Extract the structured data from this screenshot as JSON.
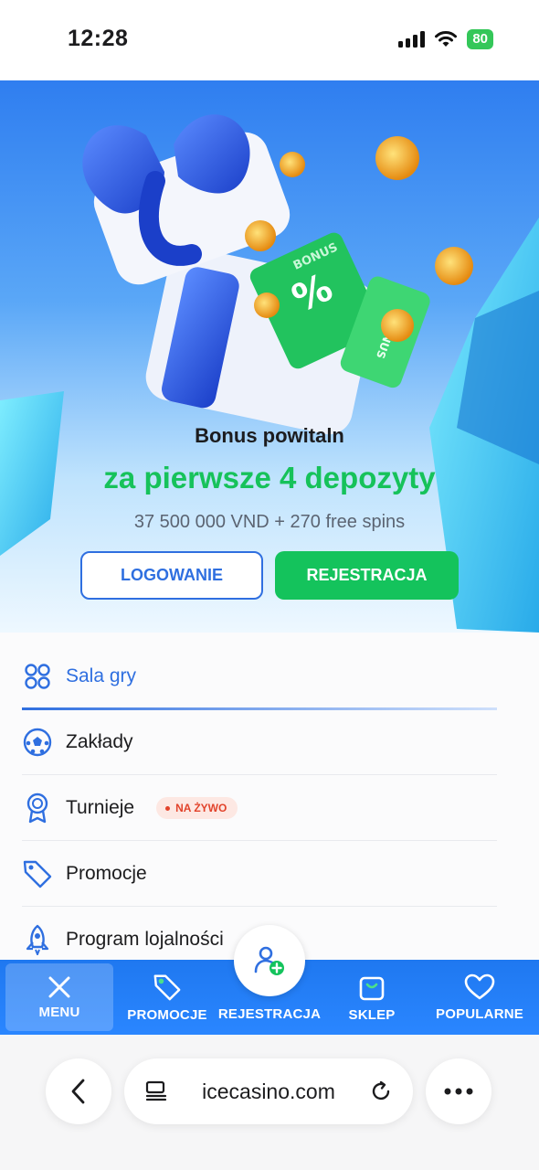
{
  "status_bar": {
    "time": "12:28",
    "battery": "80"
  },
  "hero": {
    "title": "Bonus powitaln",
    "headline": "za pierwsze 4 depozyty",
    "subtitle": "37 500 000 VND + 270 free spins",
    "login_label": "LOGOWANIE",
    "register_label": "REJESTRACJA",
    "ticket_text": "BONUS",
    "ticket_symbol": "%"
  },
  "menu": {
    "items": [
      {
        "label": "Sala gry",
        "icon": "grid-icon",
        "active": true
      },
      {
        "label": "Zakłady",
        "icon": "soccer-ball-icon"
      },
      {
        "label": "Turnieje",
        "icon": "medal-icon",
        "badge": "NA ŻYWO"
      },
      {
        "label": "Promocje",
        "icon": "tag-icon"
      },
      {
        "label": "Program lojalności",
        "icon": "rocket-icon"
      }
    ]
  },
  "bottom_nav": {
    "items": [
      {
        "label": "MENU",
        "icon": "close-icon",
        "active": true
      },
      {
        "label": "PROMOCJE",
        "icon": "tag-icon"
      },
      {
        "label": "REJESTRACJA",
        "icon": "add-user-icon"
      },
      {
        "label": "SKLEP",
        "icon": "shopping-bag-icon"
      },
      {
        "label": "POPULARNE",
        "icon": "heart-icon"
      }
    ]
  },
  "browser": {
    "url": "icecasino.com"
  },
  "colors": {
    "accent_blue": "#2f6fe0",
    "accent_green": "#14c35c",
    "nav_blue": "#1f78f0",
    "live_red": "#e2432b"
  }
}
